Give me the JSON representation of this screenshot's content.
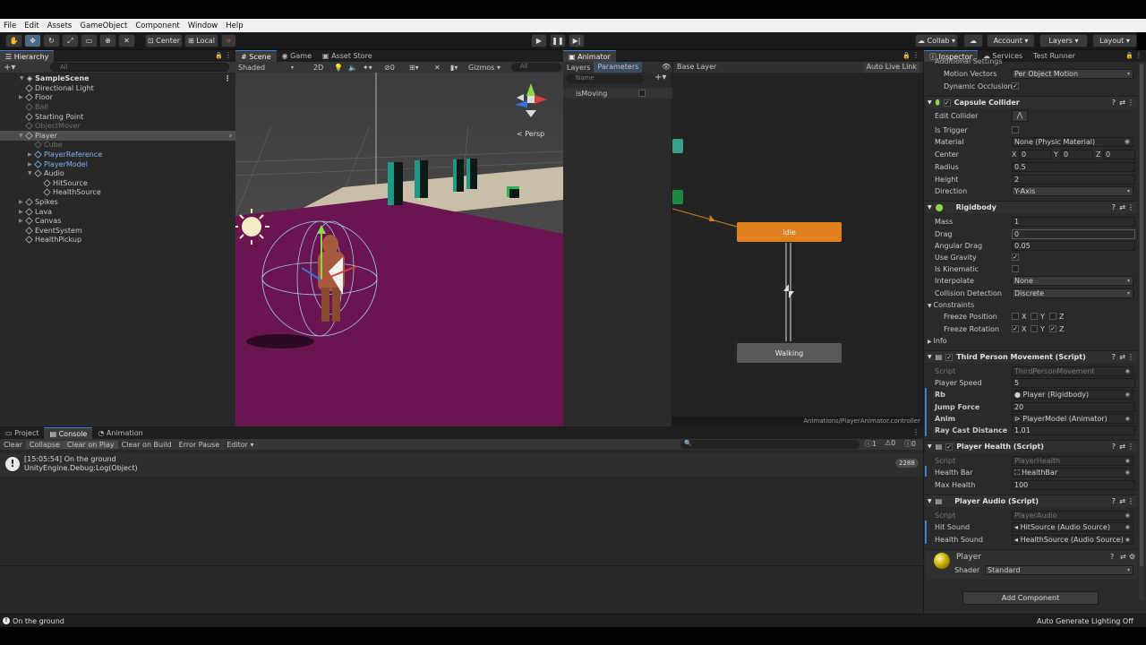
{
  "menu": [
    "File",
    "Edit",
    "Assets",
    "GameObject",
    "Component",
    "Window",
    "Help"
  ],
  "toolbar": {
    "center": "Center",
    "local": "Local",
    "collab": "Collab",
    "account": "Account",
    "layers": "Layers",
    "layout": "Layout"
  },
  "hierarchy": {
    "tab": "Hierarchy",
    "search": "All",
    "scene": "SampleScene",
    "items": [
      {
        "label": "Directional Light",
        "indent": 1
      },
      {
        "label": "Floor",
        "indent": 1
      },
      {
        "label": "Ball",
        "indent": 1,
        "style": "dim"
      },
      {
        "label": "Starting Point",
        "indent": 1
      },
      {
        "label": "ObjectMover",
        "indent": 1,
        "style": "dim"
      },
      {
        "label": "Player",
        "indent": 1,
        "style": "sel"
      },
      {
        "label": "Cube",
        "indent": 2,
        "style": "dim"
      },
      {
        "label": "PlayerReference",
        "indent": 2,
        "style": "blue"
      },
      {
        "label": "PlayerModel",
        "indent": 2,
        "style": "blue"
      },
      {
        "label": "Audio",
        "indent": 2
      },
      {
        "label": "HitSource",
        "indent": 3
      },
      {
        "label": "HealthSource",
        "indent": 3
      },
      {
        "label": "Spikes",
        "indent": 1
      },
      {
        "label": "Lava",
        "indent": 1
      },
      {
        "label": "Canvas",
        "indent": 1
      },
      {
        "label": "EventSystem",
        "indent": 1
      },
      {
        "label": "HealthPickup",
        "indent": 1
      }
    ]
  },
  "scene": {
    "tabs": [
      "Scene",
      "Game",
      "Asset Store"
    ],
    "shaded": "Shaded",
    "mode2d": "2D",
    "gizmos": "Gizmos",
    "search": "All",
    "persp": "< Persp",
    "layers_count": "0"
  },
  "animator": {
    "tab": "Animator",
    "subtabs": [
      "Layers",
      "Parameters"
    ],
    "base_layer": "Base Layer",
    "auto_live": "Auto Live Link",
    "name_placeholder": "Name",
    "param": "isMoving",
    "path": "Animations/PlayerAnimator.controller",
    "states": [
      "Idle",
      "Walking"
    ]
  },
  "inspector": {
    "tabs": [
      "Inspector",
      "Services",
      "Test Runner"
    ],
    "header_cut": "Additional Settings",
    "motion_vectors": {
      "label": "Motion Vectors",
      "value": "Per Object Motion"
    },
    "dynamic_occlusion": "Dynamic Occlusion",
    "capsule": {
      "title": "Capsule Collider",
      "edit": "Edit Collider",
      "is_trigger": "Is Trigger",
      "material": "Material",
      "material_val": "None (Physic Material)",
      "center": "Center",
      "cx": "0",
      "cy": "0",
      "cz": "0",
      "radius": "Radius",
      "radius_val": "0.5",
      "height": "Height",
      "height_val": "2",
      "direction": "Direction",
      "direction_val": "Y-Axis"
    },
    "rigidbody": {
      "title": "Rigidbody",
      "mass": "Mass",
      "mass_val": "1",
      "drag": "Drag",
      "drag_val": "0",
      "angular": "Angular Drag",
      "angular_val": "0.05",
      "gravity": "Use Gravity",
      "kinematic": "Is Kinematic",
      "interp": "Interpolate",
      "interp_val": "None",
      "collision": "Collision Detection",
      "collision_val": "Discrete",
      "constraints": "Constraints",
      "freeze_pos": "Freeze Position",
      "freeze_rot": "Freeze Rotation",
      "info": "Info"
    },
    "tpm": {
      "title": "Third Person Movement (Script)",
      "script": "Script",
      "script_val": "ThirdPersonMovement",
      "speed": "Player Speed",
      "speed_val": "5",
      "rb": "Rb",
      "rb_val": "Player (Rigidbody)",
      "jump": "Jump Force",
      "jump_val": "20",
      "anim": "Anim",
      "anim_val": "PlayerModel (Animator)",
      "ray": "Ray Cast Distance",
      "ray_val": "1.01"
    },
    "health": {
      "title": "Player Health (Script)",
      "script": "Script",
      "script_val": "PlayerHealth",
      "bar": "Health Bar",
      "bar_val": "HealthBar",
      "max": "Max Health",
      "max_val": "100"
    },
    "audio": {
      "title": "Player Audio (Script)",
      "script": "Script",
      "script_val": "PlayerAudio",
      "hit": "Hit Sound",
      "hit_val": "HitSource (Audio Source)",
      "hs": "Health Sound",
      "hs_val": "HealthSource (Audio Source)"
    },
    "material": {
      "name": "Player",
      "shader": "Shader",
      "shader_val": "Standard"
    },
    "add_component": "Add Component"
  },
  "bottom": {
    "tabs": [
      "Project",
      "Console",
      "Animation"
    ],
    "buttons": [
      "Clear",
      "Collapse",
      "Clear on Play",
      "Clear on Build",
      "Error Pause",
      "Editor"
    ],
    "counts": [
      "1",
      "0",
      "0"
    ],
    "log_line1": "[15:05:54] On the ground",
    "log_line2": "UnityEngine.Debug:Log(Object)",
    "log_count": "2288"
  },
  "status": {
    "message": "On the ground",
    "right": "Auto Generate Lighting Off"
  },
  "colors": {
    "bg": "#282828",
    "accent": "#3a7fd5",
    "idle": "#e0801e",
    "purple": "#6a1450"
  }
}
